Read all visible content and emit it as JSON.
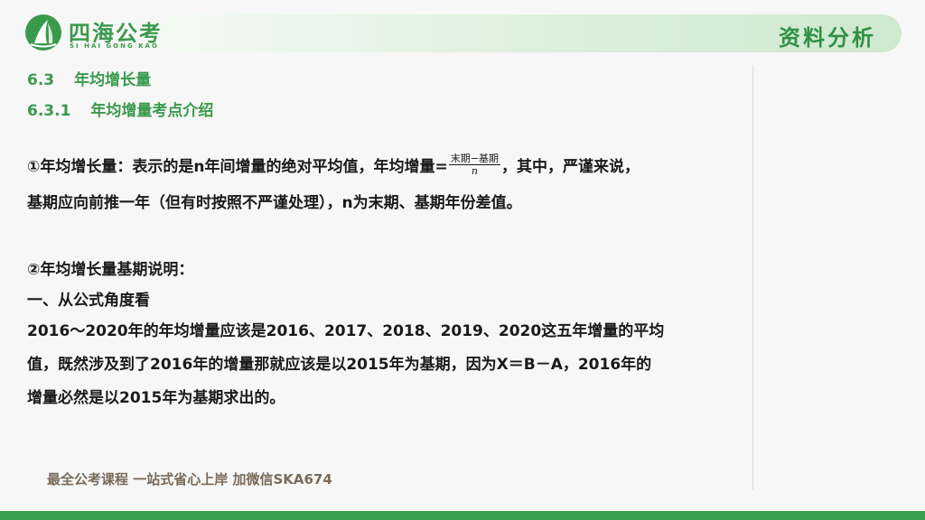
{
  "header": {
    "logo_text": "四海公考",
    "logo_sub": "SI HAI GONG KAO",
    "section_title": "资料分析",
    "accent_color": "#3a9a4c"
  },
  "headings": {
    "h2_num": "6.3",
    "h2_text": "年均增长量",
    "h3_num": "6.3.1",
    "h3_text": "年均增量考点介绍"
  },
  "para1": {
    "line1_pre": "①年均增长量：表示的是n年间增量的绝对平均值，年均增量=",
    "frac_numerator": "末期−基期",
    "frac_denominator": "n",
    "line1_post": "，其中，严谨来说，",
    "line2": "基期应向前推一年（但有时按照不严谨处理），n为末期、基期年份差值。"
  },
  "para2": {
    "title": "②年均增长量基期说明：",
    "sub": "一、从公式角度看",
    "line1": "2016～2020年的年均增量应该是2016、2017、2018、2019、2020这五年增量的平均",
    "line2": "值，既然涉及到了2016年的增量那就应该是以2015年为基期，因为X＝B－A，2016年的",
    "line3": "增量必然是以2015年为基期求出的。"
  },
  "footer": {
    "text": "最全公考课程 一站式省心上岸 加微信SKA674"
  }
}
